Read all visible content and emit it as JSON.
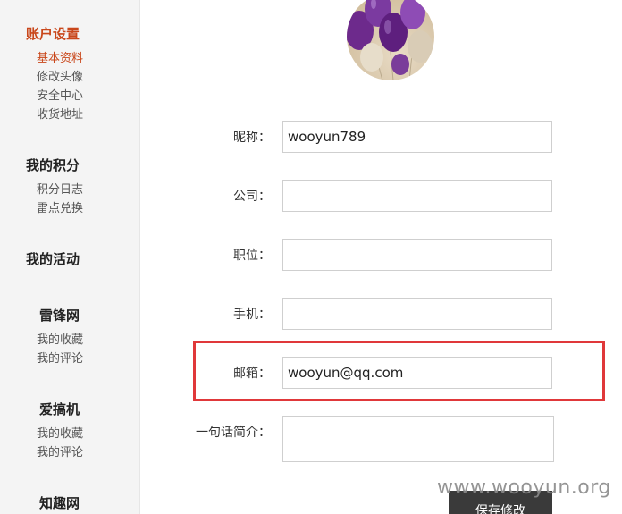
{
  "sidebar": {
    "account_settings": {
      "title": "账户设置",
      "items": [
        "基本资料",
        "修改头像",
        "安全中心",
        "收货地址"
      ]
    },
    "my_points": {
      "title": "我的积分",
      "items": [
        "积分日志",
        "雷点兑换"
      ]
    },
    "my_activities": {
      "title": "我的活动"
    },
    "leifeng": {
      "title": "雷锋网",
      "items": [
        "我的收藏",
        "我的评论"
      ]
    },
    "aigaoji": {
      "title": "爱搞机",
      "items": [
        "我的收藏",
        "我的评论"
      ]
    },
    "zhiqu": {
      "title": "知趣网"
    }
  },
  "avatar": {
    "icon": "balloons-avatar-image"
  },
  "form": {
    "nickname": {
      "label": "昵称：",
      "value": "wooyun789"
    },
    "company": {
      "label": "公司：",
      "value": ""
    },
    "position": {
      "label": "职位：",
      "value": ""
    },
    "phone": {
      "label": "手机：",
      "value": ""
    },
    "email": {
      "label": "邮箱：",
      "value": "wooyun@qq.com"
    },
    "bio": {
      "label": "一句话简介：",
      "value": ""
    },
    "save_label": "保存修改"
  },
  "highlight_color": "#e0383a",
  "accent_color": "#c9471b",
  "watermark": "www.wooyun.org"
}
